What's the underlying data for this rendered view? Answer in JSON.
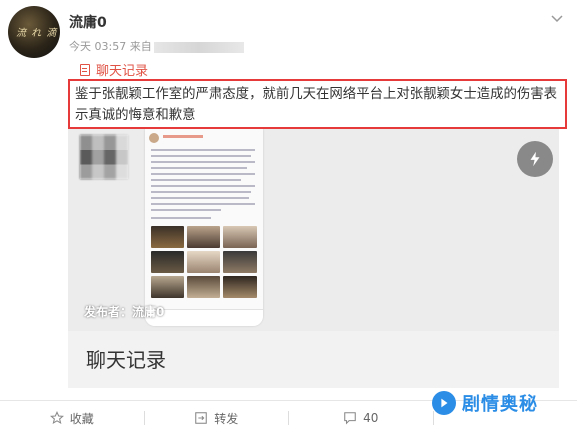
{
  "post": {
    "username": "流庸0",
    "time": "今天 03:57",
    "source_prefix": "来自",
    "avatar_text": "流 れ 滴"
  },
  "tag": {
    "label": "聊天记录"
  },
  "content": {
    "text": "鉴于张靓颖工作室的严肃态度，就前几天在网络平台上对张靓颖女士造成的伤害表示真诚的悔意和歉意"
  },
  "card": {
    "publisher": "发布者：流庸0",
    "title": "聊天记录"
  },
  "actions": {
    "favorite": "收藏",
    "repost": "转发",
    "comment_count": "40",
    "like_count": ""
  },
  "watermark": {
    "text": "剧情奥秘"
  },
  "colors": {
    "highlight_border": "#e63a3a",
    "tag": "#e05244",
    "watermark": "#2b8de6"
  }
}
